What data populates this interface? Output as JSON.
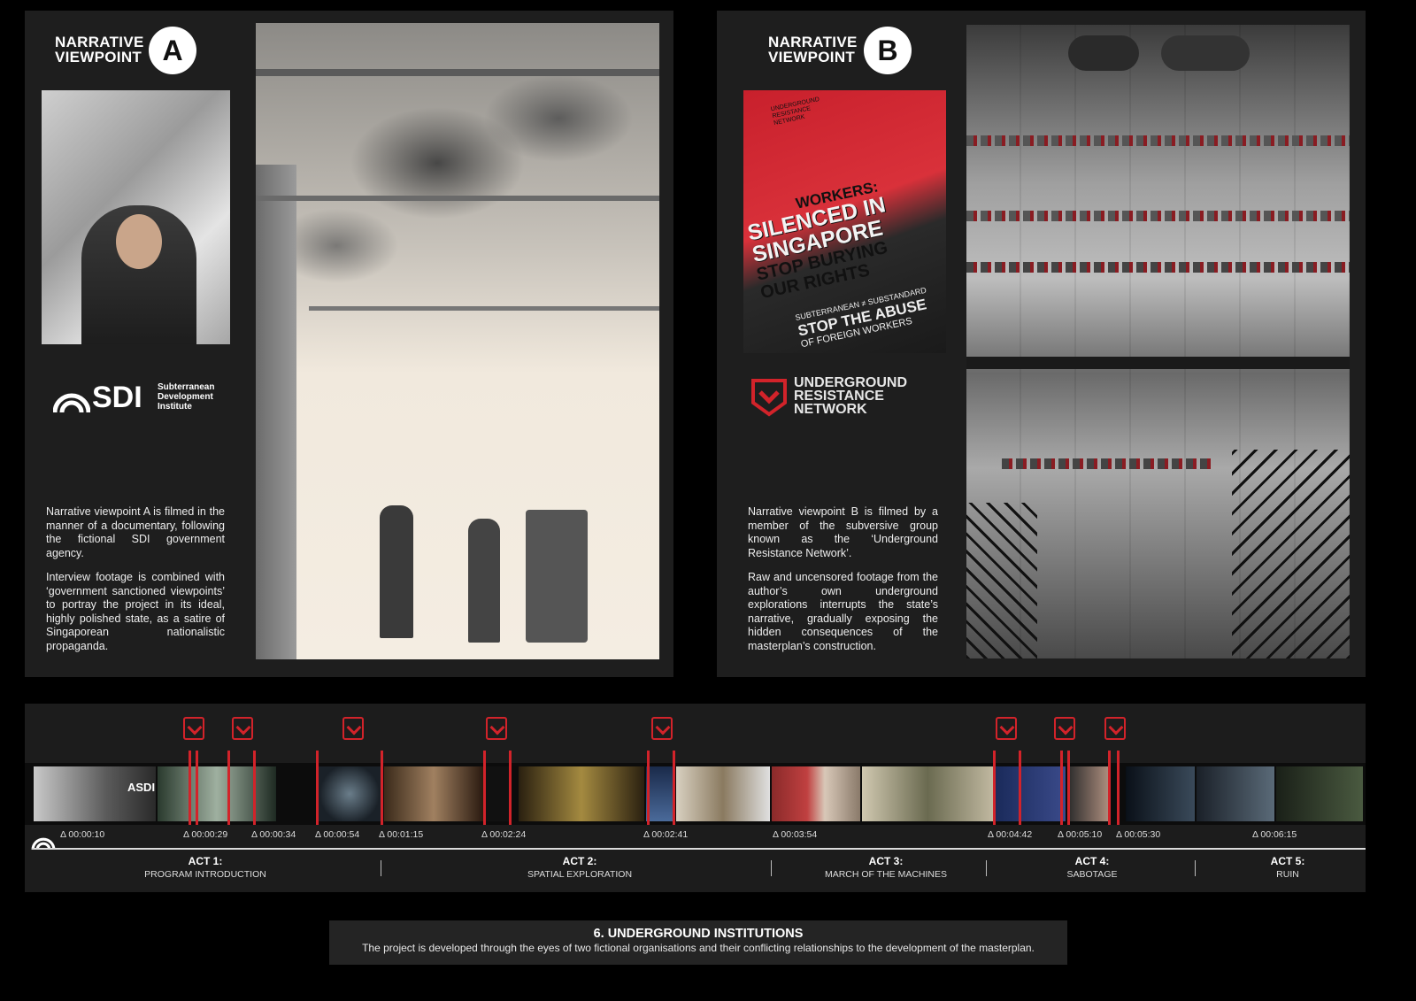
{
  "viewpoint_a": {
    "title_line1": "NARRATIVE",
    "title_line2": "VIEWPOINT",
    "letter": "A",
    "logo_mark": "SDI",
    "logo_text_1": "Subterranean",
    "logo_text_2": "Development",
    "logo_text_3": "Institute",
    "paragraph_1": "Narrative viewpoint A is filmed in the manner of a documentary, following the fictional SDI government agency.",
    "paragraph_2": "Interview footage is combined with ‘government sanctioned viewpoints’ to portray the project in its ideal, highly polished state, as a satire of Singaporean nationalistic propaganda."
  },
  "viewpoint_b": {
    "title_line1": "NARRATIVE",
    "title_line2": "VIEWPOINT",
    "letter": "B",
    "poster": {
      "network": "UNDERGROUND RESISTANCE NETWORK",
      "line_1": "WORKERS:",
      "line_2": "SILENCED IN",
      "line_3": "SINGAPORE",
      "line_4": "STOP BURYING",
      "line_5": "OUR RIGHTS",
      "tag": "SUBTERRANEAN ≠ SUBSTANDARD",
      "line_6": "STOP THE ABUSE",
      "line_7": "OF FOREIGN WORKERS"
    },
    "logo_line_1": "UNDERGROUND",
    "logo_line_2": "RESISTANCE",
    "logo_line_3": "NETWORK",
    "paragraph_1": "Narrative viewpoint B is filmed by a member of the subversive group known as the ‘Underground Resistance Network’.",
    "paragraph_2": "Raw and uncensored footage from the author’s own underground explorations interrupts the state’s narrative, gradually exposing the hidden consequences of the masterplan’s construction."
  },
  "timeline": {
    "timestamps": [
      "Δ 00:00:10",
      "Δ 00:00:29",
      "Δ 00:00:34",
      "Δ 00:00:54",
      "Δ 00:01:15",
      "Δ 00:02:24",
      "Δ 00:02:41",
      "Δ 00:03:54",
      "Δ 00:04:42",
      "Δ 00:05:10",
      "Δ 00:05:30",
      "Δ 00:06:15"
    ],
    "acts": [
      {
        "number": "ACT 1:",
        "name": "PROGRAM INTRODUCTION"
      },
      {
        "number": "ACT 2:",
        "name": "SPATIAL EXPLORATION"
      },
      {
        "number": "ACT 3:",
        "name": "MARCH OF THE MACHINES"
      },
      {
        "number": "ACT 4:",
        "name": "SABOTAGE"
      },
      {
        "number": "ACT 5:",
        "name": "RUIN"
      }
    ],
    "thumbnail_caption": "ASDI"
  },
  "caption": {
    "title": "6. UNDERGROUND INSTITUTIONS",
    "text": "The project is developed through the eyes of two fictional organisations and their conflicting relationships to the development of the masterplan."
  },
  "colors": {
    "accent_red": "#d2232a",
    "panel": "#1e1e1e",
    "background": "#000000"
  }
}
